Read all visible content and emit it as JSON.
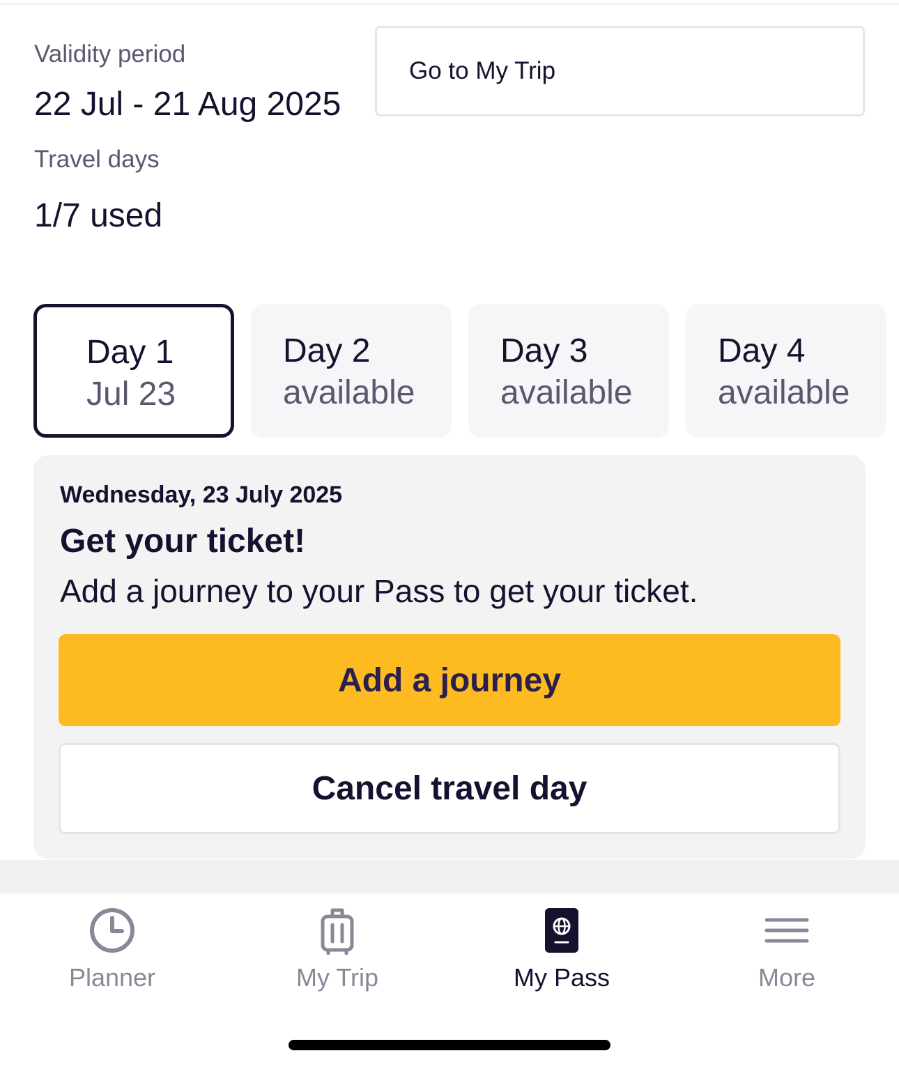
{
  "summary": {
    "validity_label": "Validity period",
    "validity_value": "22 Jul - 21 Aug 2025",
    "travel_days_label": "Travel days",
    "travel_days_value": "1/7 used",
    "go_to_trip_label": "Go to My Trip"
  },
  "day_tabs": [
    {
      "title": "Day 1",
      "subtitle": "Jul 23",
      "selected": true
    },
    {
      "title": "Day 2",
      "subtitle": "available",
      "selected": false
    },
    {
      "title": "Day 3",
      "subtitle": "available",
      "selected": false
    },
    {
      "title": "Day 4",
      "subtitle": "available",
      "selected": false
    }
  ],
  "ticket_card": {
    "date": "Wednesday, 23 July 2025",
    "title": "Get your ticket!",
    "description": "Add a journey to your Pass to get your ticket.",
    "primary_button": "Add a journey",
    "secondary_button": "Cancel travel day"
  },
  "tab_bar": {
    "items": [
      {
        "label": "Planner",
        "icon": "clock-icon",
        "active": false
      },
      {
        "label": "My Trip",
        "icon": "suitcase-icon",
        "active": false
      },
      {
        "label": "My Pass",
        "icon": "passport-icon",
        "active": true
      },
      {
        "label": "More",
        "icon": "menu-icon",
        "active": false
      }
    ]
  },
  "colors": {
    "text_primary": "#15112e",
    "text_secondary": "#5a5870",
    "accent_yellow": "#fdbb21",
    "card_background": "#f3f3f4",
    "inactive_tab": "#8a8898"
  }
}
